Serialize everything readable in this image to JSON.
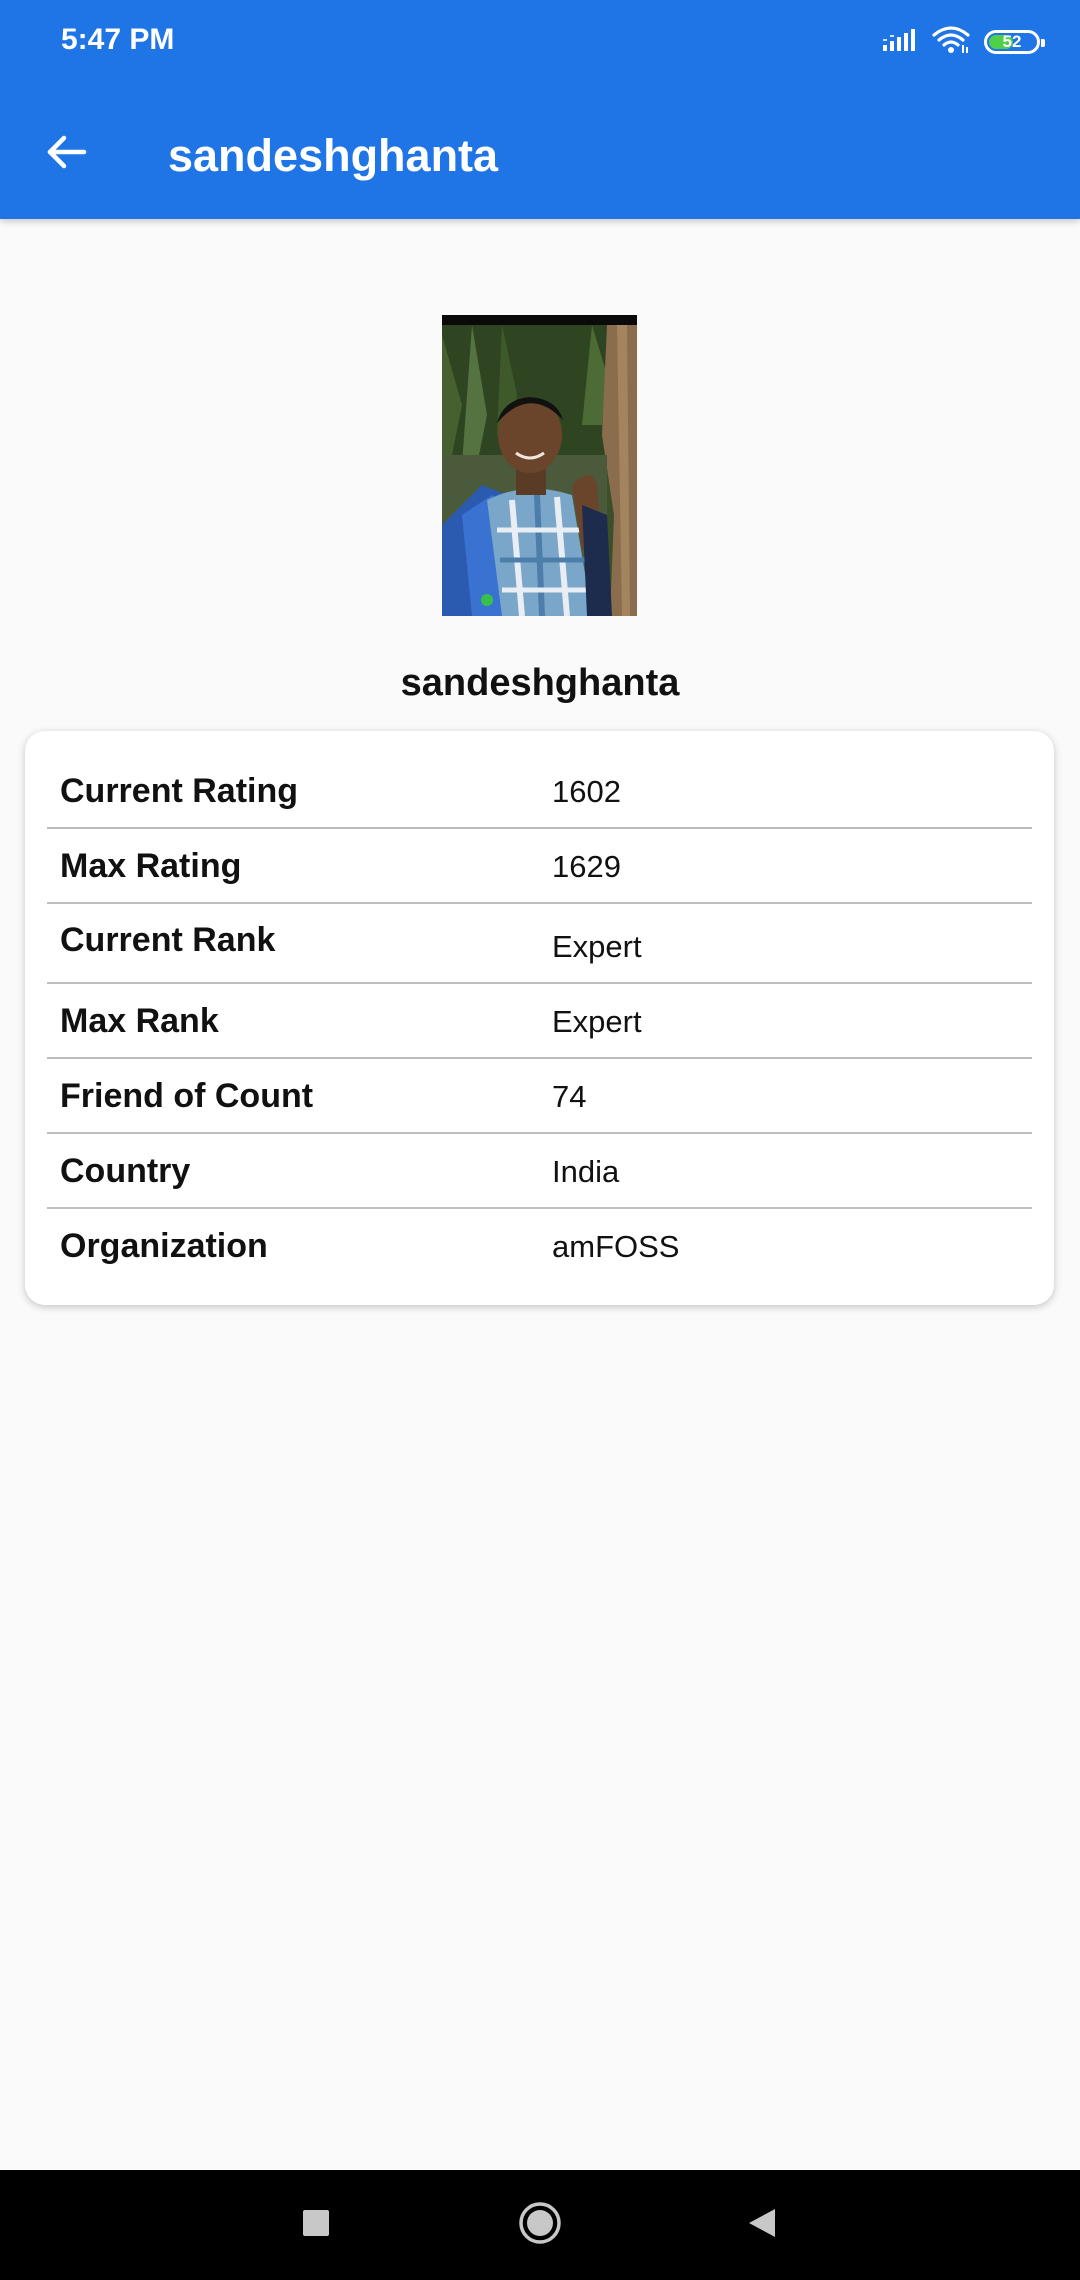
{
  "status_bar": {
    "time": "5:47 PM",
    "battery_level": "52",
    "battery_fraction": 0.52,
    "icons": [
      "signal-icon",
      "wifi-icon",
      "battery-icon"
    ]
  },
  "app_bar": {
    "title": "sandeshghanta",
    "back_icon": "arrow-left-icon",
    "color": "#1f74e6"
  },
  "profile": {
    "name": "sandeshghanta"
  },
  "details": [
    {
      "label": "Current Rating",
      "value": "1602"
    },
    {
      "label": "Max Rating",
      "value": "1629"
    },
    {
      "label": "Current Rank",
      "value": "Expert"
    },
    {
      "label": "Max Rank",
      "value": "Expert"
    },
    {
      "label": "Friend of Count",
      "value": "74"
    },
    {
      "label": "Country",
      "value": "India"
    },
    {
      "label": "Organization",
      "value": "amFOSS"
    }
  ],
  "nav_bar": {
    "icons": [
      "recent-apps-icon",
      "home-icon",
      "back-icon"
    ]
  }
}
